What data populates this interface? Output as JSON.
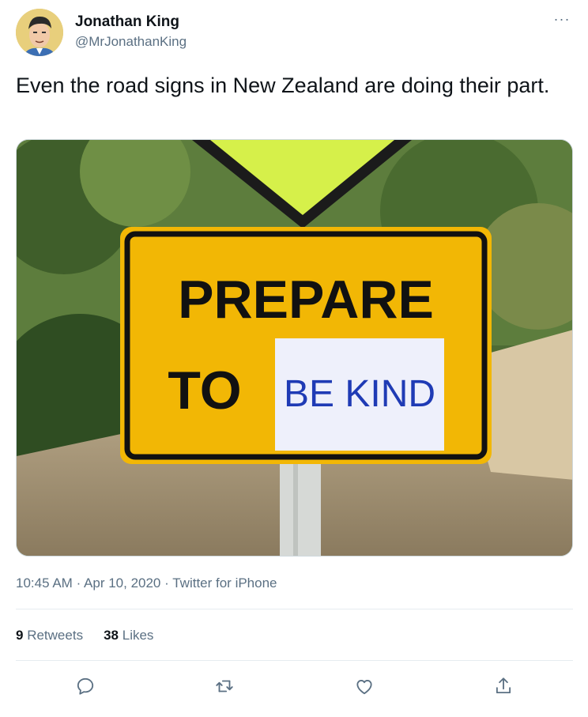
{
  "author": {
    "display_name": "Jonathan King",
    "handle": "@MrJonathanKing"
  },
  "tweet": {
    "text": "Even the road signs in New Zealand are doing their part."
  },
  "media": {
    "sign_text_line1": "PREPARE",
    "sign_text_line2": "TO",
    "paper_text": "BE KIND"
  },
  "meta": {
    "time": "10:45 AM",
    "date": "Apr 10, 2020",
    "source": "Twitter for iPhone",
    "separator": "·"
  },
  "stats": {
    "retweets_count": "9",
    "retweets_label": "Retweets",
    "likes_count": "38",
    "likes_label": "Likes"
  },
  "icons": {
    "more": "more-icon",
    "reply": "reply-icon",
    "retweet": "retweet-icon",
    "like": "like-icon",
    "share": "share-icon"
  },
  "colors": {
    "text_primary": "#0f1419",
    "text_secondary": "#5b7083",
    "divider": "#e6ecf0",
    "sign_yellow": "#f2b705"
  }
}
